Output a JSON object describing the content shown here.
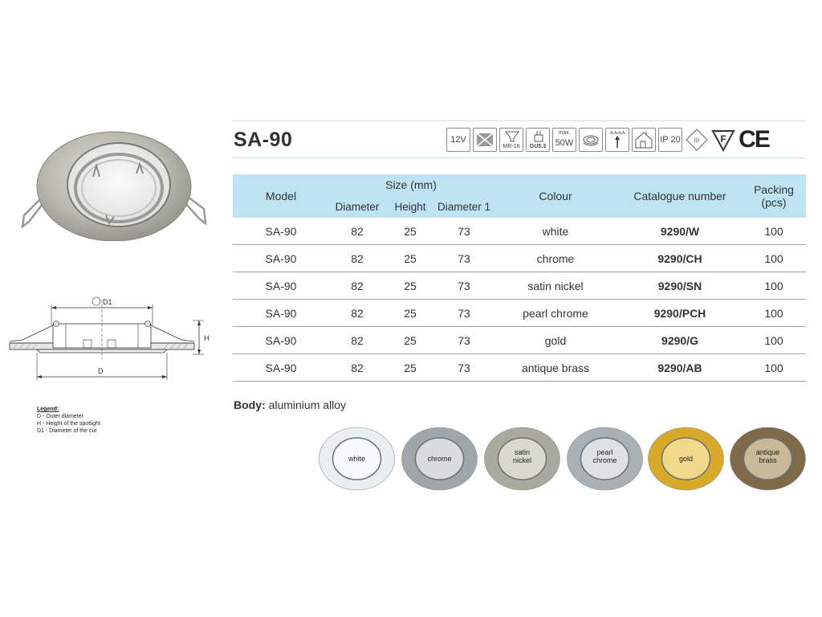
{
  "header": {
    "model_title": "SA-90",
    "icons": [
      {
        "name": "voltage-12v-icon",
        "text": "12V"
      },
      {
        "name": "transformer-icon",
        "text": ""
      },
      {
        "name": "bulb-mr16-icon",
        "text": "MR-16"
      },
      {
        "name": "socket-gu53-icon",
        "text": "GU5.3"
      },
      {
        "name": "max-power-icon",
        "top": "max.",
        "text": "50W"
      },
      {
        "name": "adjustable-angle-icon",
        "text": ""
      },
      {
        "name": "ceiling-mount-icon",
        "text": ""
      },
      {
        "name": "indoor-use-icon",
        "text": ""
      },
      {
        "name": "ip-rating-icon",
        "text": "IP 20"
      },
      {
        "name": "class-iii-icon",
        "text": "III"
      },
      {
        "name": "f-mark-icon",
        "text": "F"
      },
      {
        "name": "ce-mark-icon",
        "text": "CE"
      }
    ]
  },
  "table": {
    "headers": {
      "model": "Model",
      "size": "Size (mm)",
      "diameter": "Diameter",
      "height": "Height",
      "diameter1": "Diameter 1",
      "colour": "Colour",
      "catalogue": "Catalogue number",
      "packing": "Packing",
      "packing_unit": "(pcs)"
    },
    "rows": [
      {
        "model": "SA-90",
        "diameter": "82",
        "height": "25",
        "diameter1": "73",
        "colour": "white",
        "catalogue": "9290/W",
        "packing": "100"
      },
      {
        "model": "SA-90",
        "diameter": "82",
        "height": "25",
        "diameter1": "73",
        "colour": "chrome",
        "catalogue": "9290/CH",
        "packing": "100"
      },
      {
        "model": "SA-90",
        "diameter": "82",
        "height": "25",
        "diameter1": "73",
        "colour": "satin nickel",
        "catalogue": "9290/SN",
        "packing": "100"
      },
      {
        "model": "SA-90",
        "diameter": "82",
        "height": "25",
        "diameter1": "73",
        "colour": "pearl chrome",
        "catalogue": "9290/PCH",
        "packing": "100"
      },
      {
        "model": "SA-90",
        "diameter": "82",
        "height": "25",
        "diameter1": "73",
        "colour": "gold",
        "catalogue": "9290/G",
        "packing": "100"
      },
      {
        "model": "SA-90",
        "diameter": "82",
        "height": "25",
        "diameter1": "73",
        "colour": "antique brass",
        "catalogue": "9290/AB",
        "packing": "100"
      }
    ]
  },
  "body_note": {
    "label": "Body:",
    "value": "aluminium alloy"
  },
  "drawing": {
    "d1_label": "D1",
    "d_label": "D",
    "h_label": "H"
  },
  "legend": {
    "title": "Legend:",
    "items": [
      "D - Outer diameter",
      "H - Height of the spotlight",
      "D1 - Diameter of the cut"
    ]
  },
  "swatches": [
    {
      "line1": "white",
      "line2": "",
      "ring": "#e9eef0",
      "inner": "#f7fafb"
    },
    {
      "line1": "chrome",
      "line2": "",
      "ring": "#9fa6aa",
      "inner": "#d8dcde"
    },
    {
      "line1": "satin",
      "line2": "nickel",
      "ring": "#a9a99f",
      "inner": "#d9d8d0"
    },
    {
      "line1": "pearl",
      "line2": "chrome",
      "ring": "#a9b0b6",
      "inner": "#dde1e4"
    },
    {
      "line1": "gold",
      "line2": "",
      "ring": "#d8a92a",
      "inner": "#f1d98a"
    },
    {
      "line1": "antique",
      "line2": "brass",
      "ring": "#7e6a4a",
      "inner": "#c8b99a"
    }
  ]
}
